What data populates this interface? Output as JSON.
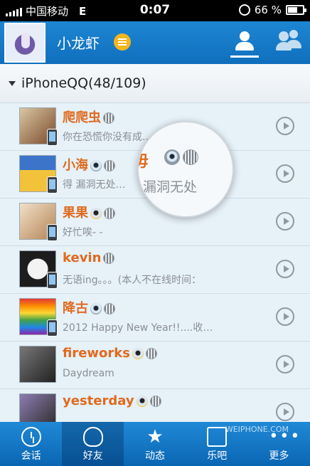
{
  "status_bar": {
    "carrier": "中国移动",
    "network": "E",
    "time": "0:07",
    "battery": "66 %"
  },
  "header": {
    "profile_name": "小龙虾"
  },
  "group": {
    "label": "iPhoneQQ(48/109)"
  },
  "contacts": [
    {
      "name": "爬爬虫",
      "signature": "你在恐慌你没有成…………",
      "colors": [
        "#d9c6a3",
        "#7a4a2a"
      ]
    },
    {
      "name": "小海",
      "signature": "得 漏洞无处…",
      "colors": [
        "#3b74c9",
        "#f2c23a"
      ]
    },
    {
      "name": "果果",
      "signature": "好忙唉- -",
      "colors": [
        "#f1dfc9",
        "#b48554"
      ]
    },
    {
      "name": "kevin",
      "signature": "无语ing。。。(本人不在线时间：",
      "colors": [
        "#1d1d1d",
        "#f3f3f3"
      ]
    },
    {
      "name": "降古",
      "signature": "2012 Happy New Year!!....收…",
      "colors": [
        "#e53935",
        "#fdd835"
      ]
    },
    {
      "name": "fireworks",
      "signature": "Daydream",
      "colors": [
        "#222",
        "#777"
      ]
    },
    {
      "name": "yesterday",
      "signature": "",
      "colors": [
        "#8d7db0",
        "#2a2a2a"
      ]
    }
  ],
  "magnifier": {
    "name_fragment": "毋",
    "signature_fragment": "漏洞无处"
  },
  "tabs": [
    {
      "label": "会话",
      "icon": "chat-icon"
    },
    {
      "label": "好友",
      "icon": "friends-icon"
    },
    {
      "label": "动态",
      "icon": "star-icon"
    },
    {
      "label": "乐吧",
      "icon": "music-icon"
    },
    {
      "label": "更多",
      "icon": "more-icon"
    }
  ],
  "watermark": "WEIPHONE.COM"
}
